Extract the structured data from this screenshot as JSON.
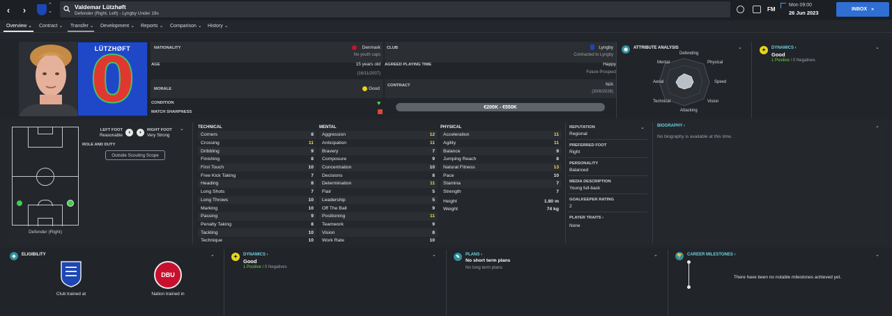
{
  "header": {
    "player_name": "Valdemar Lützhøft",
    "player_sub": "Defender (Right, Left) - Lyngby Under 19s",
    "time": "Mon 09:00",
    "date": "26 Jun 2023",
    "fm_label": "FM",
    "inbox_label": "INBOX"
  },
  "menu": [
    {
      "label": "Overview"
    },
    {
      "label": "Contract"
    },
    {
      "label": "Transfer"
    },
    {
      "label": "Development"
    },
    {
      "label": "Reports"
    },
    {
      "label": "Comparison"
    },
    {
      "label": "History"
    }
  ],
  "profile": {
    "shirt_name": "LÜTZHØFT",
    "shirt_number": "0",
    "nationality_label": "NATIONALITY",
    "nationality": "Denmark",
    "youth_caps": "No youth caps",
    "club_label": "CLUB",
    "club": "Lyngby",
    "club_sub": "Contracted to Lyngby",
    "age_label": "AGE",
    "age": "15 years old",
    "dob": "(16/11/2007)",
    "playing_time_label": "AGREED PLAYING TIME",
    "playing_time": "Happy",
    "playing_time_sub": "Future Prospect",
    "morale_label": "MORALE",
    "morale": "Good",
    "contract_label": "CONTRACT",
    "contract": "N/A",
    "contract_sub": "(30/6/2026)",
    "condition_label": "CONDITION",
    "sharpness_label": "MATCH SHARPNESS",
    "value_range": "€200K - €550K"
  },
  "attribute_analysis": {
    "title": "ATTRIBUTE ANALYSIS",
    "axes": [
      "Defending",
      "Physical",
      "Speed",
      "Vision",
      "Attacking",
      "Technical",
      "Aerial",
      "Mental"
    ]
  },
  "dynamics_top": {
    "title": "DYNAMICS",
    "value": "Good",
    "positives": "1 Positive",
    "slash": "/",
    "negatives": "0 Negatives"
  },
  "position": {
    "left_foot_label": "LEFT FOOT",
    "left_foot": "Reasonable",
    "right_foot_label": "RIGHT FOOT",
    "right_foot": "Very Strong",
    "role_label": "ROLE AND DUTY",
    "scouting_button": "Outside Scouting Scope",
    "position_caption": "Defender (Right)"
  },
  "technical": {
    "title": "TECHNICAL",
    "rows": [
      {
        "name": "Corners",
        "value": "8"
      },
      {
        "name": "Crossing",
        "value": "11"
      },
      {
        "name": "Dribbling",
        "value": "9"
      },
      {
        "name": "Finishing",
        "value": "8"
      },
      {
        "name": "First Touch",
        "value": "10"
      },
      {
        "name": "Free Kick Taking",
        "value": "7"
      },
      {
        "name": "Heading",
        "value": "8"
      },
      {
        "name": "Long Shots",
        "value": "7"
      },
      {
        "name": "Long Throws",
        "value": "10"
      },
      {
        "name": "Marking",
        "value": "10"
      },
      {
        "name": "Passing",
        "value": "9"
      },
      {
        "name": "Penalty Taking",
        "value": "8"
      },
      {
        "name": "Tackling",
        "value": "10"
      },
      {
        "name": "Technique",
        "value": "10"
      }
    ]
  },
  "mental": {
    "title": "MENTAL",
    "rows": [
      {
        "name": "Aggression",
        "value": "12"
      },
      {
        "name": "Anticipation",
        "value": "11"
      },
      {
        "name": "Bravery",
        "value": "7"
      },
      {
        "name": "Composure",
        "value": "9"
      },
      {
        "name": "Concentration",
        "value": "10"
      },
      {
        "name": "Decisions",
        "value": "8"
      },
      {
        "name": "Determination",
        "value": "11"
      },
      {
        "name": "Flair",
        "value": "5"
      },
      {
        "name": "Leadership",
        "value": "5"
      },
      {
        "name": "Off The Ball",
        "value": "9"
      },
      {
        "name": "Positioning",
        "value": "11"
      },
      {
        "name": "Teamwork",
        "value": "9"
      },
      {
        "name": "Vision",
        "value": "8"
      },
      {
        "name": "Work Rate",
        "value": "10"
      }
    ]
  },
  "physical": {
    "title": "PHYSICAL",
    "rows": [
      {
        "name": "Acceleration",
        "value": "11"
      },
      {
        "name": "Agility",
        "value": "11"
      },
      {
        "name": "Balance",
        "value": "9"
      },
      {
        "name": "Jumping Reach",
        "value": "8"
      },
      {
        "name": "Natural Fitness",
        "value": "13"
      },
      {
        "name": "Pace",
        "value": "10"
      },
      {
        "name": "Stamina",
        "value": "7"
      },
      {
        "name": "Strength",
        "value": "7"
      }
    ],
    "height_label": "Height",
    "height": "1.80 m",
    "weight_label": "Weight",
    "weight": "74 kg"
  },
  "info": {
    "reputation_label": "REPUTATION",
    "reputation": "Regional",
    "preferred_foot_label": "PREFERRED FOOT",
    "preferred_foot": "Right",
    "personality_label": "PERSONALITY",
    "personality": "Balanced",
    "media_label": "MEDIA DESCRIPTION",
    "media": "Young full-back",
    "gk_label": "GOALKEEPER RATING",
    "gk": "2",
    "traits_label": "PLAYER TRAITS",
    "traits": "None"
  },
  "biography": {
    "title": "BIOGRAPHY",
    "text": "No biography is available at this time."
  },
  "eligibility": {
    "title": "ELIGIBILITY",
    "club_caption": "Club trained at",
    "nation_caption": "Nation trained in",
    "dbu": "DBU"
  },
  "dynamics_bottom": {
    "title": "DYNAMICS",
    "value": "Good",
    "positives": "1 Positive",
    "slash": "/",
    "negatives": "0 Negatives"
  },
  "plans": {
    "title": "PLANS",
    "short": "No short term plans",
    "long": "No long term plans"
  },
  "milestones": {
    "title": "CAREER MILESTONES",
    "text": "There have been no notable milestones achieved yet."
  }
}
